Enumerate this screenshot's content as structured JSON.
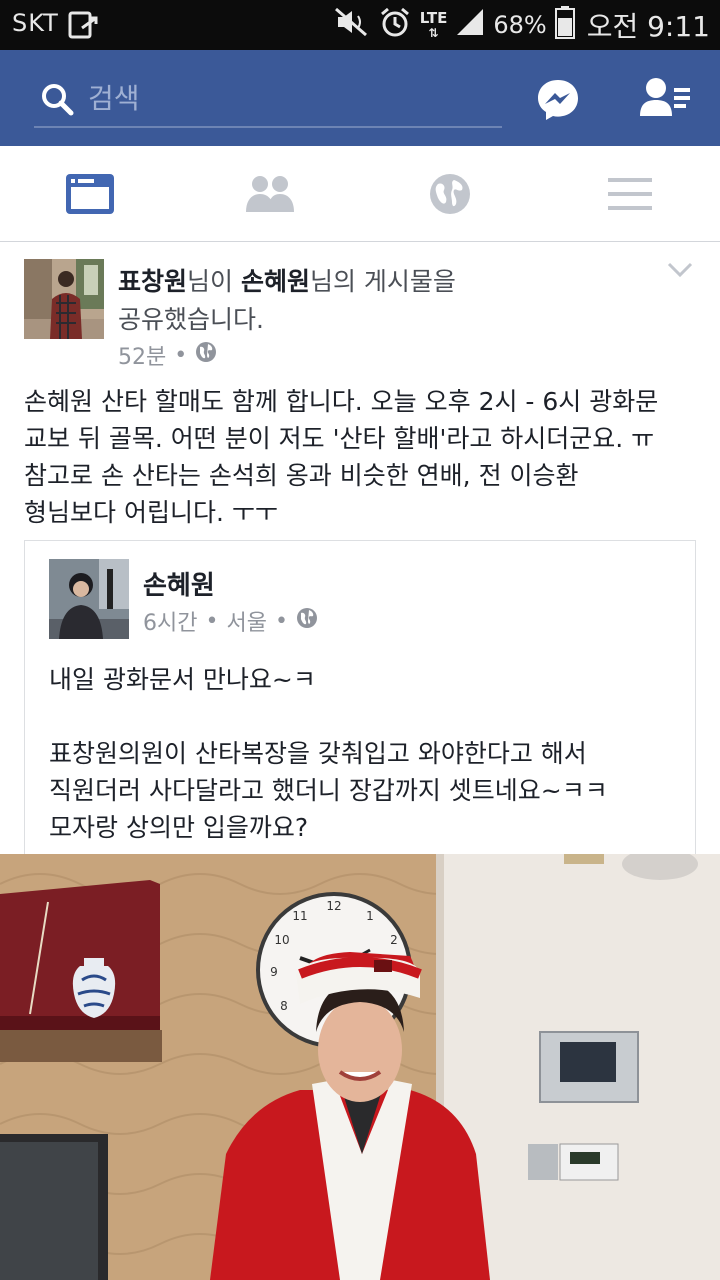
{
  "status_bar": {
    "carrier": "SKT",
    "network": "LTE",
    "battery": "68%",
    "time": "오전 9:11"
  },
  "header": {
    "search_placeholder": "검색",
    "icons": [
      "search-icon",
      "messenger-icon",
      "friend-requests-icon"
    ],
    "background": "#3b5998"
  },
  "tabs": [
    {
      "name": "news-feed",
      "active": true
    },
    {
      "name": "friends",
      "active": false
    },
    {
      "name": "notifications",
      "active": false
    },
    {
      "name": "menu",
      "active": false
    }
  ],
  "post": {
    "actor": "표창원",
    "actor_suffix": "님이 ",
    "original_author": "손혜원",
    "action": "님의 게시물을",
    "action_line2": "공유했습니다.",
    "time": "52분",
    "separator": "•",
    "privacy_icon": "globe-icon",
    "text_lines": [
      "손혜원 산타 할매도 함께 합니다. 오늘 오후 2시 - 6시 광화문",
      "교보 뒤 골목. 어떤 분이 저도 '산타 할배'라고 하시더군요. ㅠ",
      "참고로 손 산타는 손석희 옹과 비슷한 연배, 전 이승환",
      "형님보다 어립니다. ㅜㅜ"
    ],
    "shared": {
      "author": "손혜원",
      "time": "6시간",
      "location": "서울",
      "separator": "•",
      "text_line1": "내일 광화문서 만나요~ㅋ",
      "text_line2": "표창원의원이 산타복장을 갖춰입고 와야한다고 해서",
      "text_line3": "직원더러 사다달라고 했더니 장갑까지 셋트네요~ㅋㅋ",
      "text_line4": "모자랑 상의만 입을까요?"
    },
    "photo_description": "santa-photo"
  }
}
